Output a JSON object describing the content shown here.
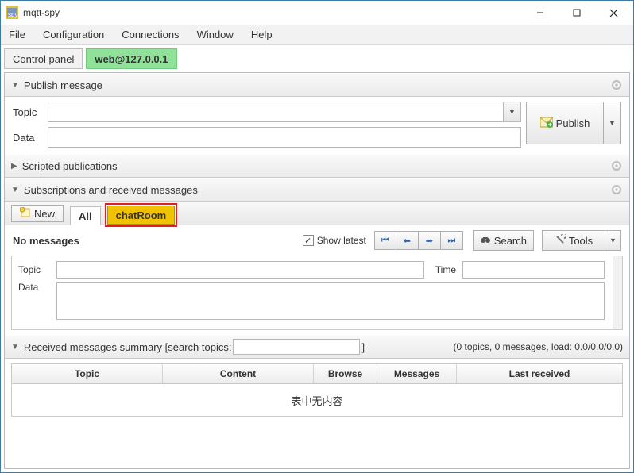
{
  "window": {
    "title": "mqtt-spy"
  },
  "menu": {
    "file": "File",
    "configuration": "Configuration",
    "connections": "Connections",
    "window": "Window",
    "help": "Help"
  },
  "tabs": {
    "control_panel": "Control panel",
    "connection": "web@127.0.0.1"
  },
  "publish": {
    "section_title": "Publish message",
    "topic_label": "Topic",
    "data_label": "Data",
    "topic_value": "",
    "data_value": "",
    "publish_btn": "Publish"
  },
  "scripted": {
    "section_title": "Scripted publications"
  },
  "subscriptions": {
    "section_title": "Subscriptions and received messages",
    "new_btn": "New",
    "tab_all": "All",
    "tab_chat": "chatRoom",
    "no_messages": "No messages",
    "show_latest": "Show latest",
    "search_btn": "Search",
    "tools_btn": "Tools",
    "topic_label": "Topic",
    "time_label": "Time",
    "data_label": "Data",
    "topic_value": "",
    "time_value": "",
    "data_value": ""
  },
  "summary": {
    "section_title_prefix": "Received messages summary [search topics:",
    "section_title_suffix": "]",
    "stats": "(0 topics, 0 messages, load: 0.0/0.0/0.0)",
    "col_topic": "Topic",
    "col_content": "Content",
    "col_browse": "Browse",
    "col_messages": "Messages",
    "col_last": "Last received",
    "empty": "表中无内容",
    "search_value": ""
  }
}
